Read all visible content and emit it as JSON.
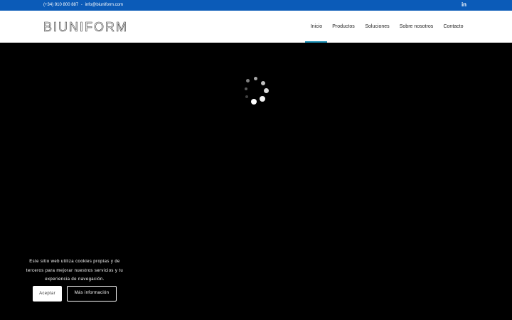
{
  "topbar": {
    "phone": "(+34) 910 800 887",
    "separator": "-",
    "email": "info@biuniform.com",
    "social_icon": "linkedin-icon",
    "social_glyph": "in"
  },
  "header": {
    "logo": "BIUNIFORM",
    "nav": [
      {
        "label": "Inicio",
        "active": true
      },
      {
        "label": "Productos",
        "active": false
      },
      {
        "label": "Soluciones",
        "active": false
      },
      {
        "label": "Sobre nosotros",
        "active": false
      },
      {
        "label": "Contacto",
        "active": false
      }
    ]
  },
  "hero": {
    "loading_icon": "loading-spinner-icon"
  },
  "cookie_banner": {
    "message": "Este sitio web utiliza cookies propias y de terceros para mejorar nuestros servicios y tu experiencia de navegación.",
    "accept_label": "Aceptar",
    "more_info_label": "Más información"
  },
  "colors": {
    "topbar_bg": "#0b5bb8",
    "nav_active_indicator": "#1a8fb5",
    "hero_bg": "#000000"
  }
}
